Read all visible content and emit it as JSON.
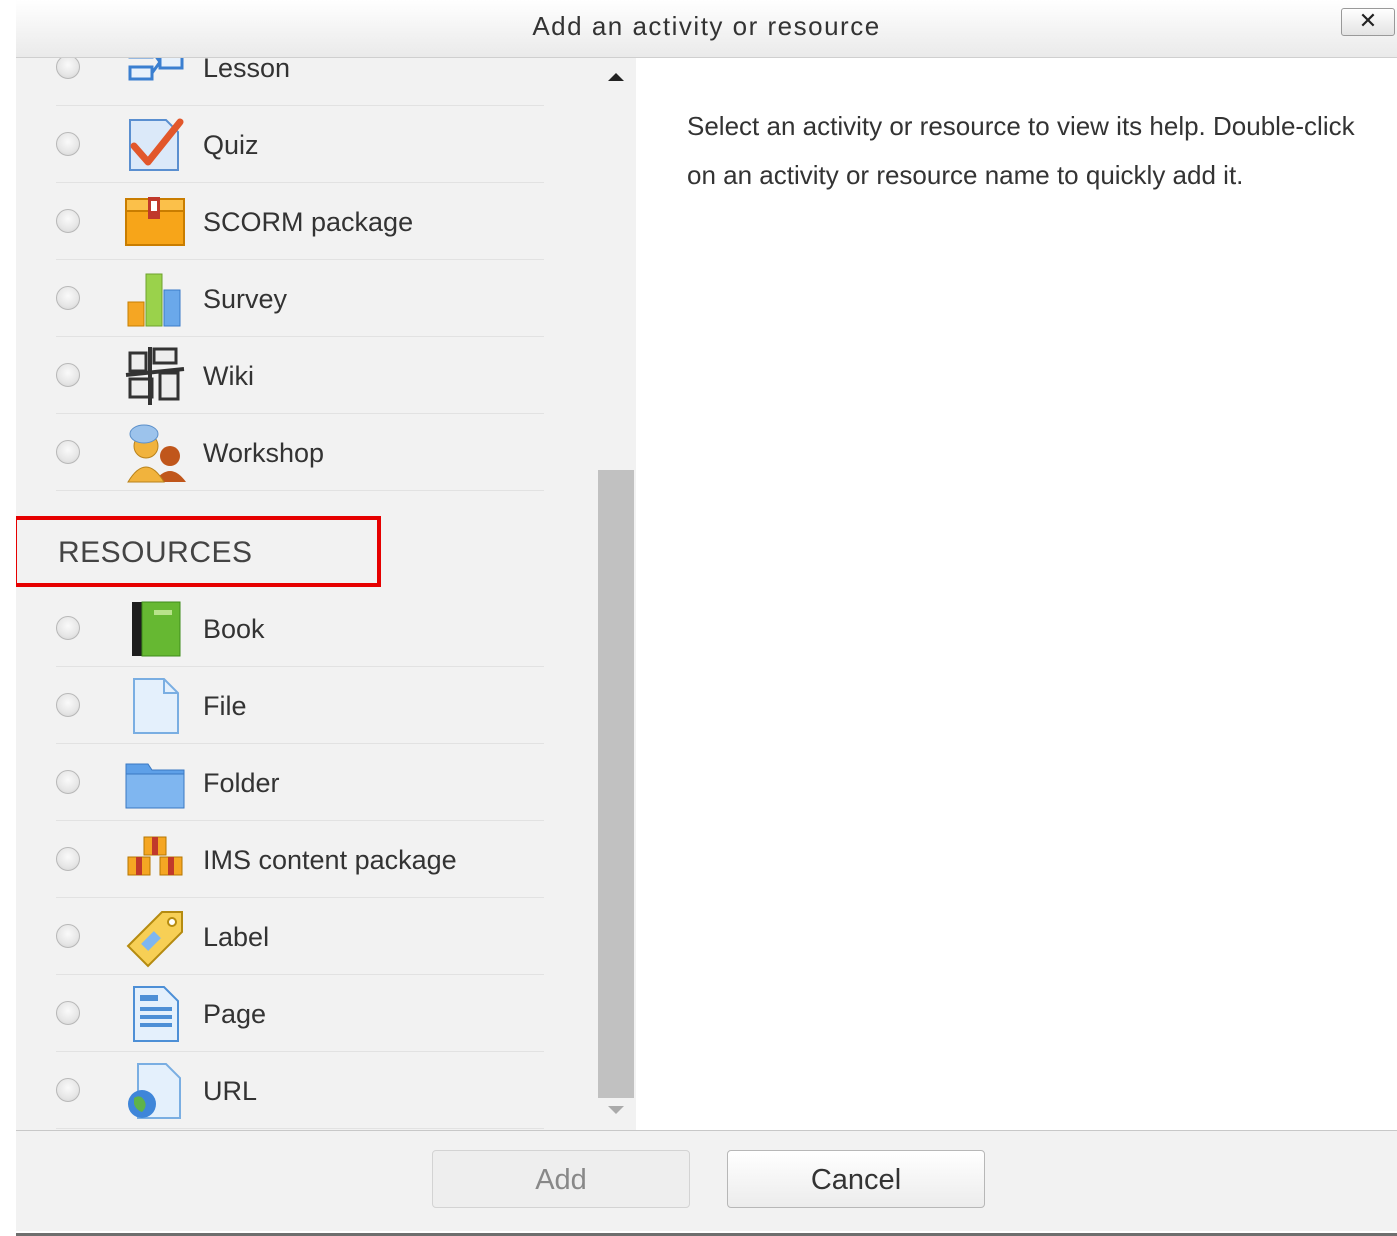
{
  "dialog": {
    "title": "Add an activity or resource",
    "close_glyph": "✕"
  },
  "activities": [
    {
      "label": "Lesson",
      "icon": "lesson-icon"
    },
    {
      "label": "Quiz",
      "icon": "quiz-icon"
    },
    {
      "label": "SCORM package",
      "icon": "scorm-package-icon"
    },
    {
      "label": "Survey",
      "icon": "survey-icon"
    },
    {
      "label": "Wiki",
      "icon": "wiki-icon"
    },
    {
      "label": "Workshop",
      "icon": "workshop-icon"
    }
  ],
  "resources_heading": "RESOURCES",
  "resources": [
    {
      "label": "Book",
      "icon": "book-icon"
    },
    {
      "label": "File",
      "icon": "file-icon"
    },
    {
      "label": "Folder",
      "icon": "folder-icon"
    },
    {
      "label": "IMS content package",
      "icon": "ims-content-package-icon"
    },
    {
      "label": "Label",
      "icon": "label-icon"
    },
    {
      "label": "Page",
      "icon": "page-icon"
    },
    {
      "label": "URL",
      "icon": "url-icon"
    }
  ],
  "help": {
    "text": "Select an activity or resource to view its help. Double-click on an activity or resource name to quickly add it."
  },
  "footer": {
    "add_label": "Add",
    "cancel_label": "Cancel"
  },
  "colors": {
    "highlight": "#e60000"
  }
}
